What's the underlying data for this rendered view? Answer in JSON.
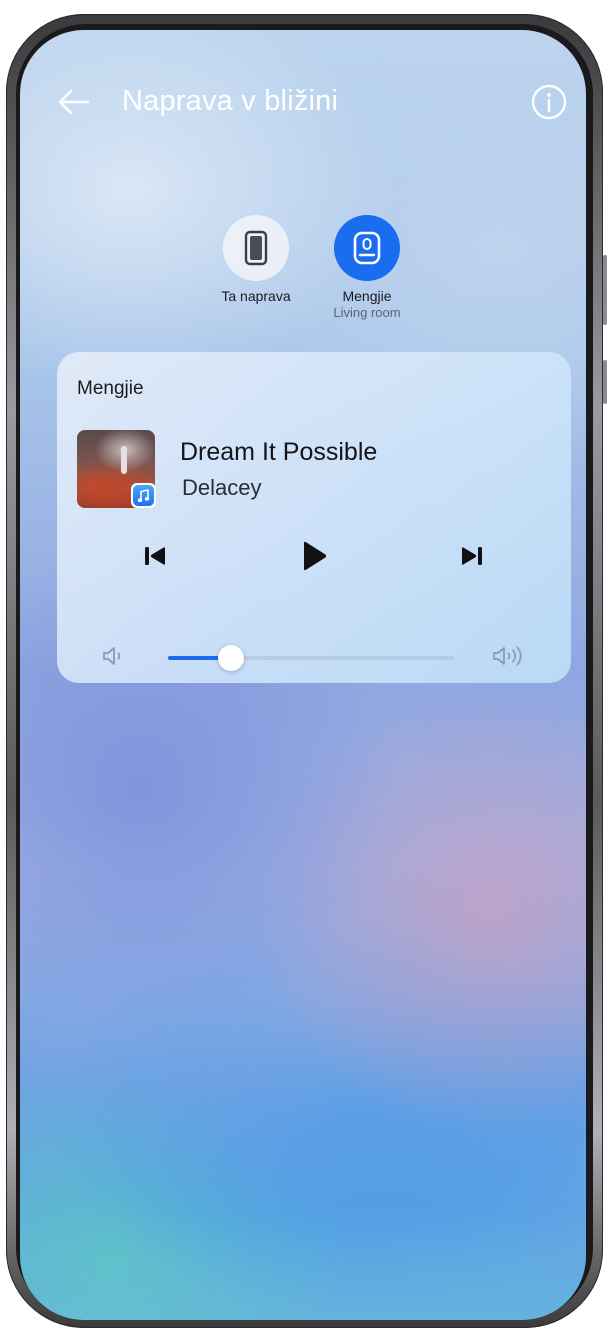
{
  "header": {
    "title": "Naprava v bližini",
    "back_icon": "arrow-left-icon",
    "info_icon": "info-circle-icon"
  },
  "devices": [
    {
      "name": "Ta naprava",
      "subtitle": "",
      "icon": "phone-icon",
      "active": false
    },
    {
      "name": "Mengjie",
      "subtitle": "Living room",
      "icon": "speaker-icon",
      "active": true
    }
  ],
  "player": {
    "device_name": "Mengjie",
    "song_title": "Dream It Possible",
    "artist": "Delacey",
    "app_badge_icon": "music-note-icon",
    "controls": {
      "previous_icon": "skip-previous-icon",
      "play_icon": "play-icon",
      "next_icon": "skip-next-icon"
    },
    "volume": {
      "level": 0.22,
      "min_icon": "volume-low-icon",
      "max_icon": "volume-high-icon"
    }
  },
  "colors": {
    "accent": "#1a6df0",
    "title_text": "#ffffff"
  }
}
